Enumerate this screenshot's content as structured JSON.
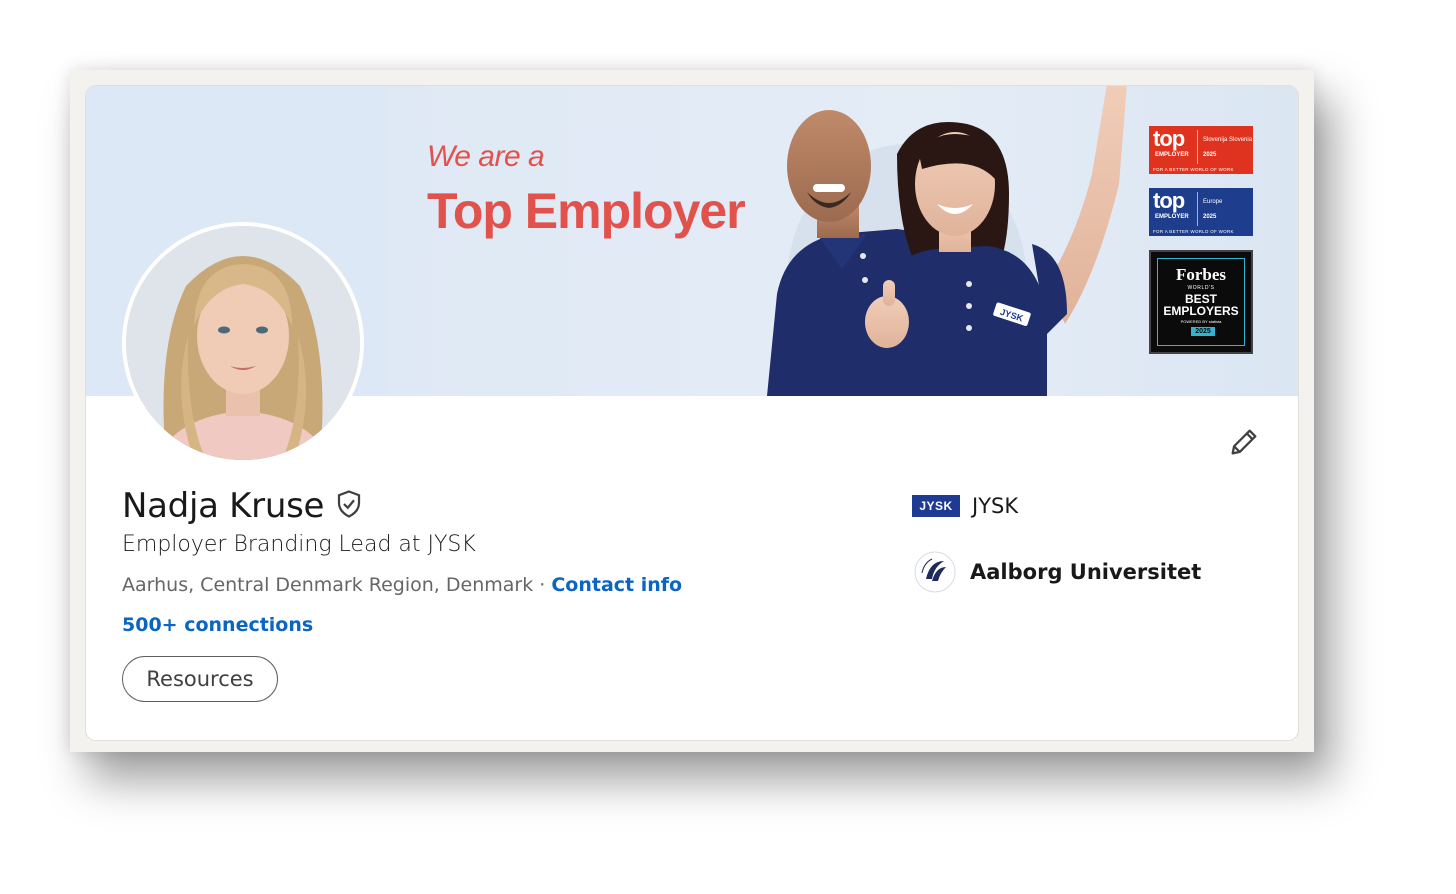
{
  "banner": {
    "subtitle": "We are a",
    "title": "Top Employer",
    "badges": {
      "top_logo": "top",
      "top_employer_word": "EMPLOYER",
      "top_tagline": "FOR A BETTER WORLD OF WORK",
      "slovenia_region": "Slovenija Slovenia",
      "europe_region": "Europe",
      "year": "2025",
      "forbes_name": "Forbes",
      "forbes_worlds": "WORLD'S",
      "forbes_best": "BEST EMPLOYERS",
      "forbes_powered": "POWERED BY statista",
      "forbes_year": "2025"
    },
    "shirt_logo": "JYSK"
  },
  "profile": {
    "name": "Nadja Kruse",
    "headline": "Employer Branding Lead at JYSK",
    "location": "Aarhus, Central Denmark Region, Denmark",
    "separator": " · ",
    "contact_info": "Contact info",
    "connections": "500+ connections",
    "resources_label": "Resources"
  },
  "organizations": [
    {
      "name": "JYSK",
      "logo_text": "JYSK"
    },
    {
      "name": "Aalborg Universitet"
    }
  ],
  "icons": {
    "edit": "pencil-icon",
    "verified": "verified-shield-icon"
  },
  "colors": {
    "accent_red": "#e2524c",
    "link_blue": "#0a66c2",
    "cover_bg": "#dce8f5",
    "badge_red": "#e0331f",
    "badge_blue": "#1e3d8c",
    "jysk_blue": "#1f3a93"
  }
}
